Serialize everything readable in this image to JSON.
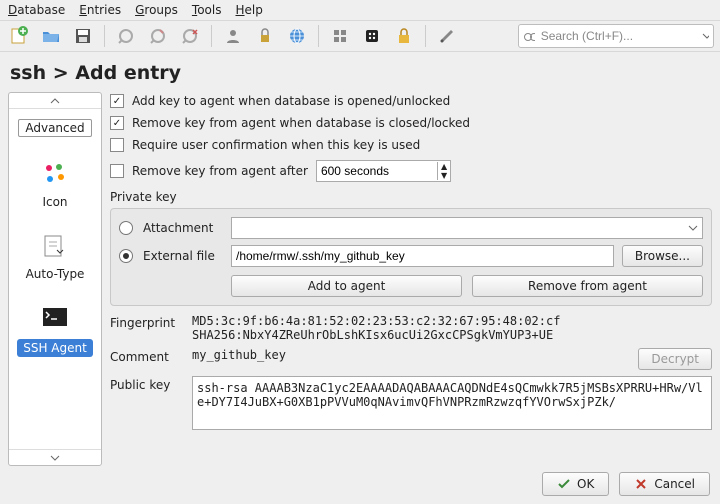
{
  "menu": [
    "Database",
    "Entries",
    "Groups",
    "Tools",
    "Help"
  ],
  "search": {
    "placeholder": "Search (Ctrl+F)..."
  },
  "breadcrumb": "ssh > Add entry",
  "sidebar": {
    "tabs": [
      {
        "label": "Advanced"
      },
      {
        "label": "Icon"
      },
      {
        "label": "Auto-Type"
      },
      {
        "label": "SSH Agent"
      }
    ]
  },
  "opts": {
    "add_key": "Add key to agent when database is opened/unlocked",
    "remove_key": "Remove key from agent when database is closed/locked",
    "require_confirm": "Require user confirmation when this key is used",
    "remove_after": "Remove key from agent after",
    "remove_after_value": "600 seconds"
  },
  "pk": {
    "section": "Private key",
    "attachment": "Attachment",
    "external": "External file",
    "external_path": "/home/rmw/.ssh/my_github_key",
    "browse": "Browse...",
    "add_to_agent": "Add to agent",
    "remove_from_agent": "Remove from agent"
  },
  "info": {
    "fingerprint_label": "Fingerprint",
    "fingerprint": "MD5:3c:9f:b6:4a:81:52:02:23:53:c2:32:67:95:48:02:cf\nSHA256:NbxY4ZReUhrObLshKIsx6ucUi2GxcCPSgkVmYUP3+UE",
    "comment_label": "Comment",
    "comment": "my_github_key",
    "decrypt": "Decrypt",
    "publickey_label": "Public key",
    "publickey": "ssh-rsa AAAAB3NzaC1yc2EAAAADAQABAAACAQDNdE4sQCmwkk7R5jMSBsXPRRU+HRw/Vle+DY7I4JuBX+G0XB1pPVVuM0qNAvimvQFhVNPRzmRzwzqfYVOrwSxjPZk/"
  },
  "footer": {
    "ok": "OK",
    "cancel": "Cancel"
  }
}
